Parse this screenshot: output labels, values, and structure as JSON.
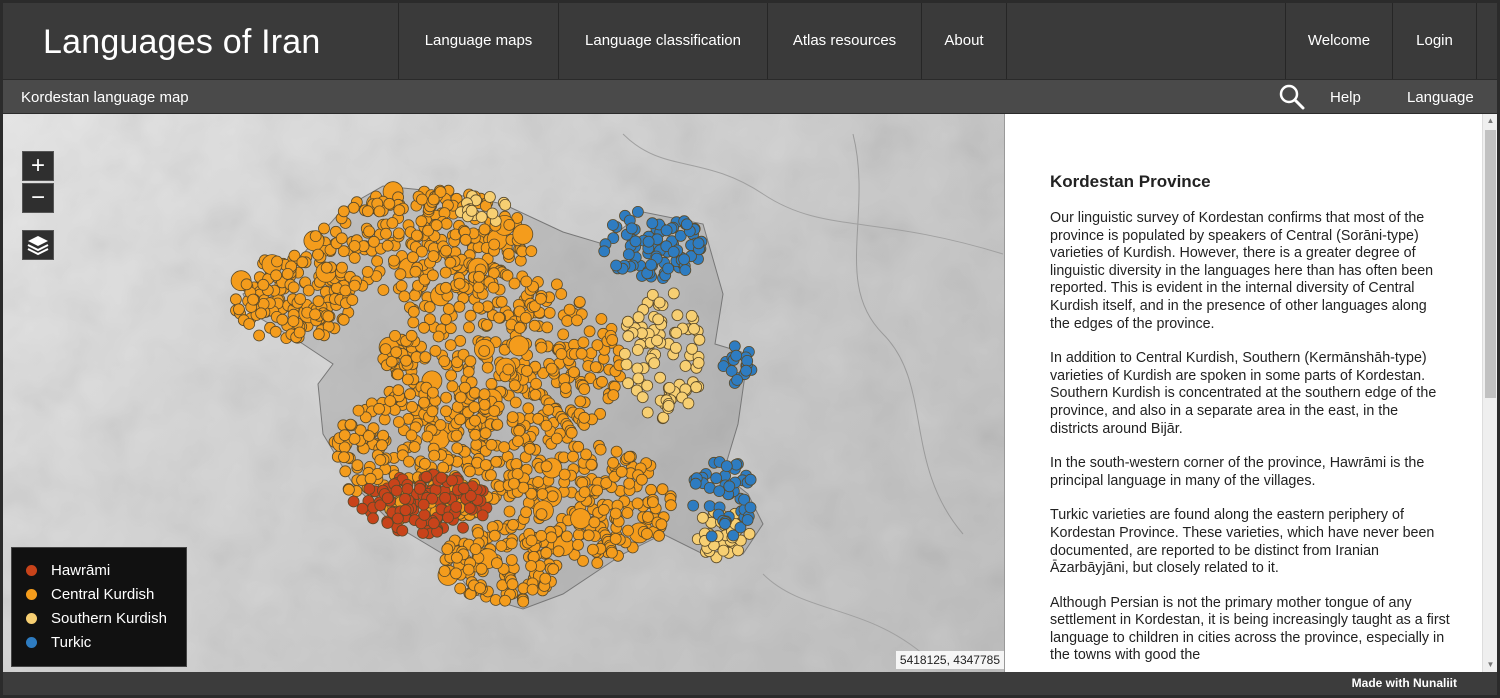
{
  "header": {
    "site_title": "Languages of Iran",
    "nav": [
      {
        "label": "Language maps"
      },
      {
        "label": "Language classification"
      },
      {
        "label": "Atlas resources"
      },
      {
        "label": "About"
      }
    ],
    "right_nav": [
      {
        "label": "Welcome"
      },
      {
        "label": "Login"
      }
    ]
  },
  "subbar": {
    "map_title": "Kordestan language map",
    "search_icon": "magnifier-icon",
    "help_label": "Help",
    "language_label": "Language"
  },
  "map": {
    "zoom_in": "+",
    "zoom_out": "−",
    "layers_icon": "layers-icon",
    "coordinates": "5418125, 4347785",
    "legend": [
      {
        "label": "Hawrāmi",
        "color": "#c8431a"
      },
      {
        "label": "Central Kurdish",
        "color": "#f49c1c"
      },
      {
        "label": "Southern Kurdish",
        "color": "#f7cf72"
      },
      {
        "label": "Turkic",
        "color": "#2e7cc1"
      }
    ]
  },
  "panel": {
    "title": "Kordestan Province",
    "paragraphs": [
      "Our linguistic survey of Kordestan confirms that most of the province is populated by speakers of Central (Sorāni-type) varieties of Kurdish. However, there is a greater degree of linguistic diversity in the languages here than has often been reported. This is evident in the internal diversity of Central Kurdish itself, and in the presence of other languages along the edges of the province.",
      "In addition to Central Kurdish, Southern (Kermānshāh-type) varieties of Kurdish are spoken in some parts of Kordestan. Southern Kurdish is concentrated at the southern edge of the province, and also in a separate area in the east, in the districts around Bijār.",
      "In the south-western corner of the province, Hawrāmi is the principal language in many of the villages.",
      "Turkic varieties are found along the eastern periphery of Kordestan Province. These varieties, which have never been documented, are reported to be distinct from Iranian Āzarbāyjāni, but closely related to it.",
      "Although Persian is not the primary mother tongue of any settlement in Kordestan, it is being increasingly taught as a first language to children in cities across the province, especially in the towns with good the"
    ]
  },
  "footer": {
    "text": "Made with Nunaliit"
  }
}
